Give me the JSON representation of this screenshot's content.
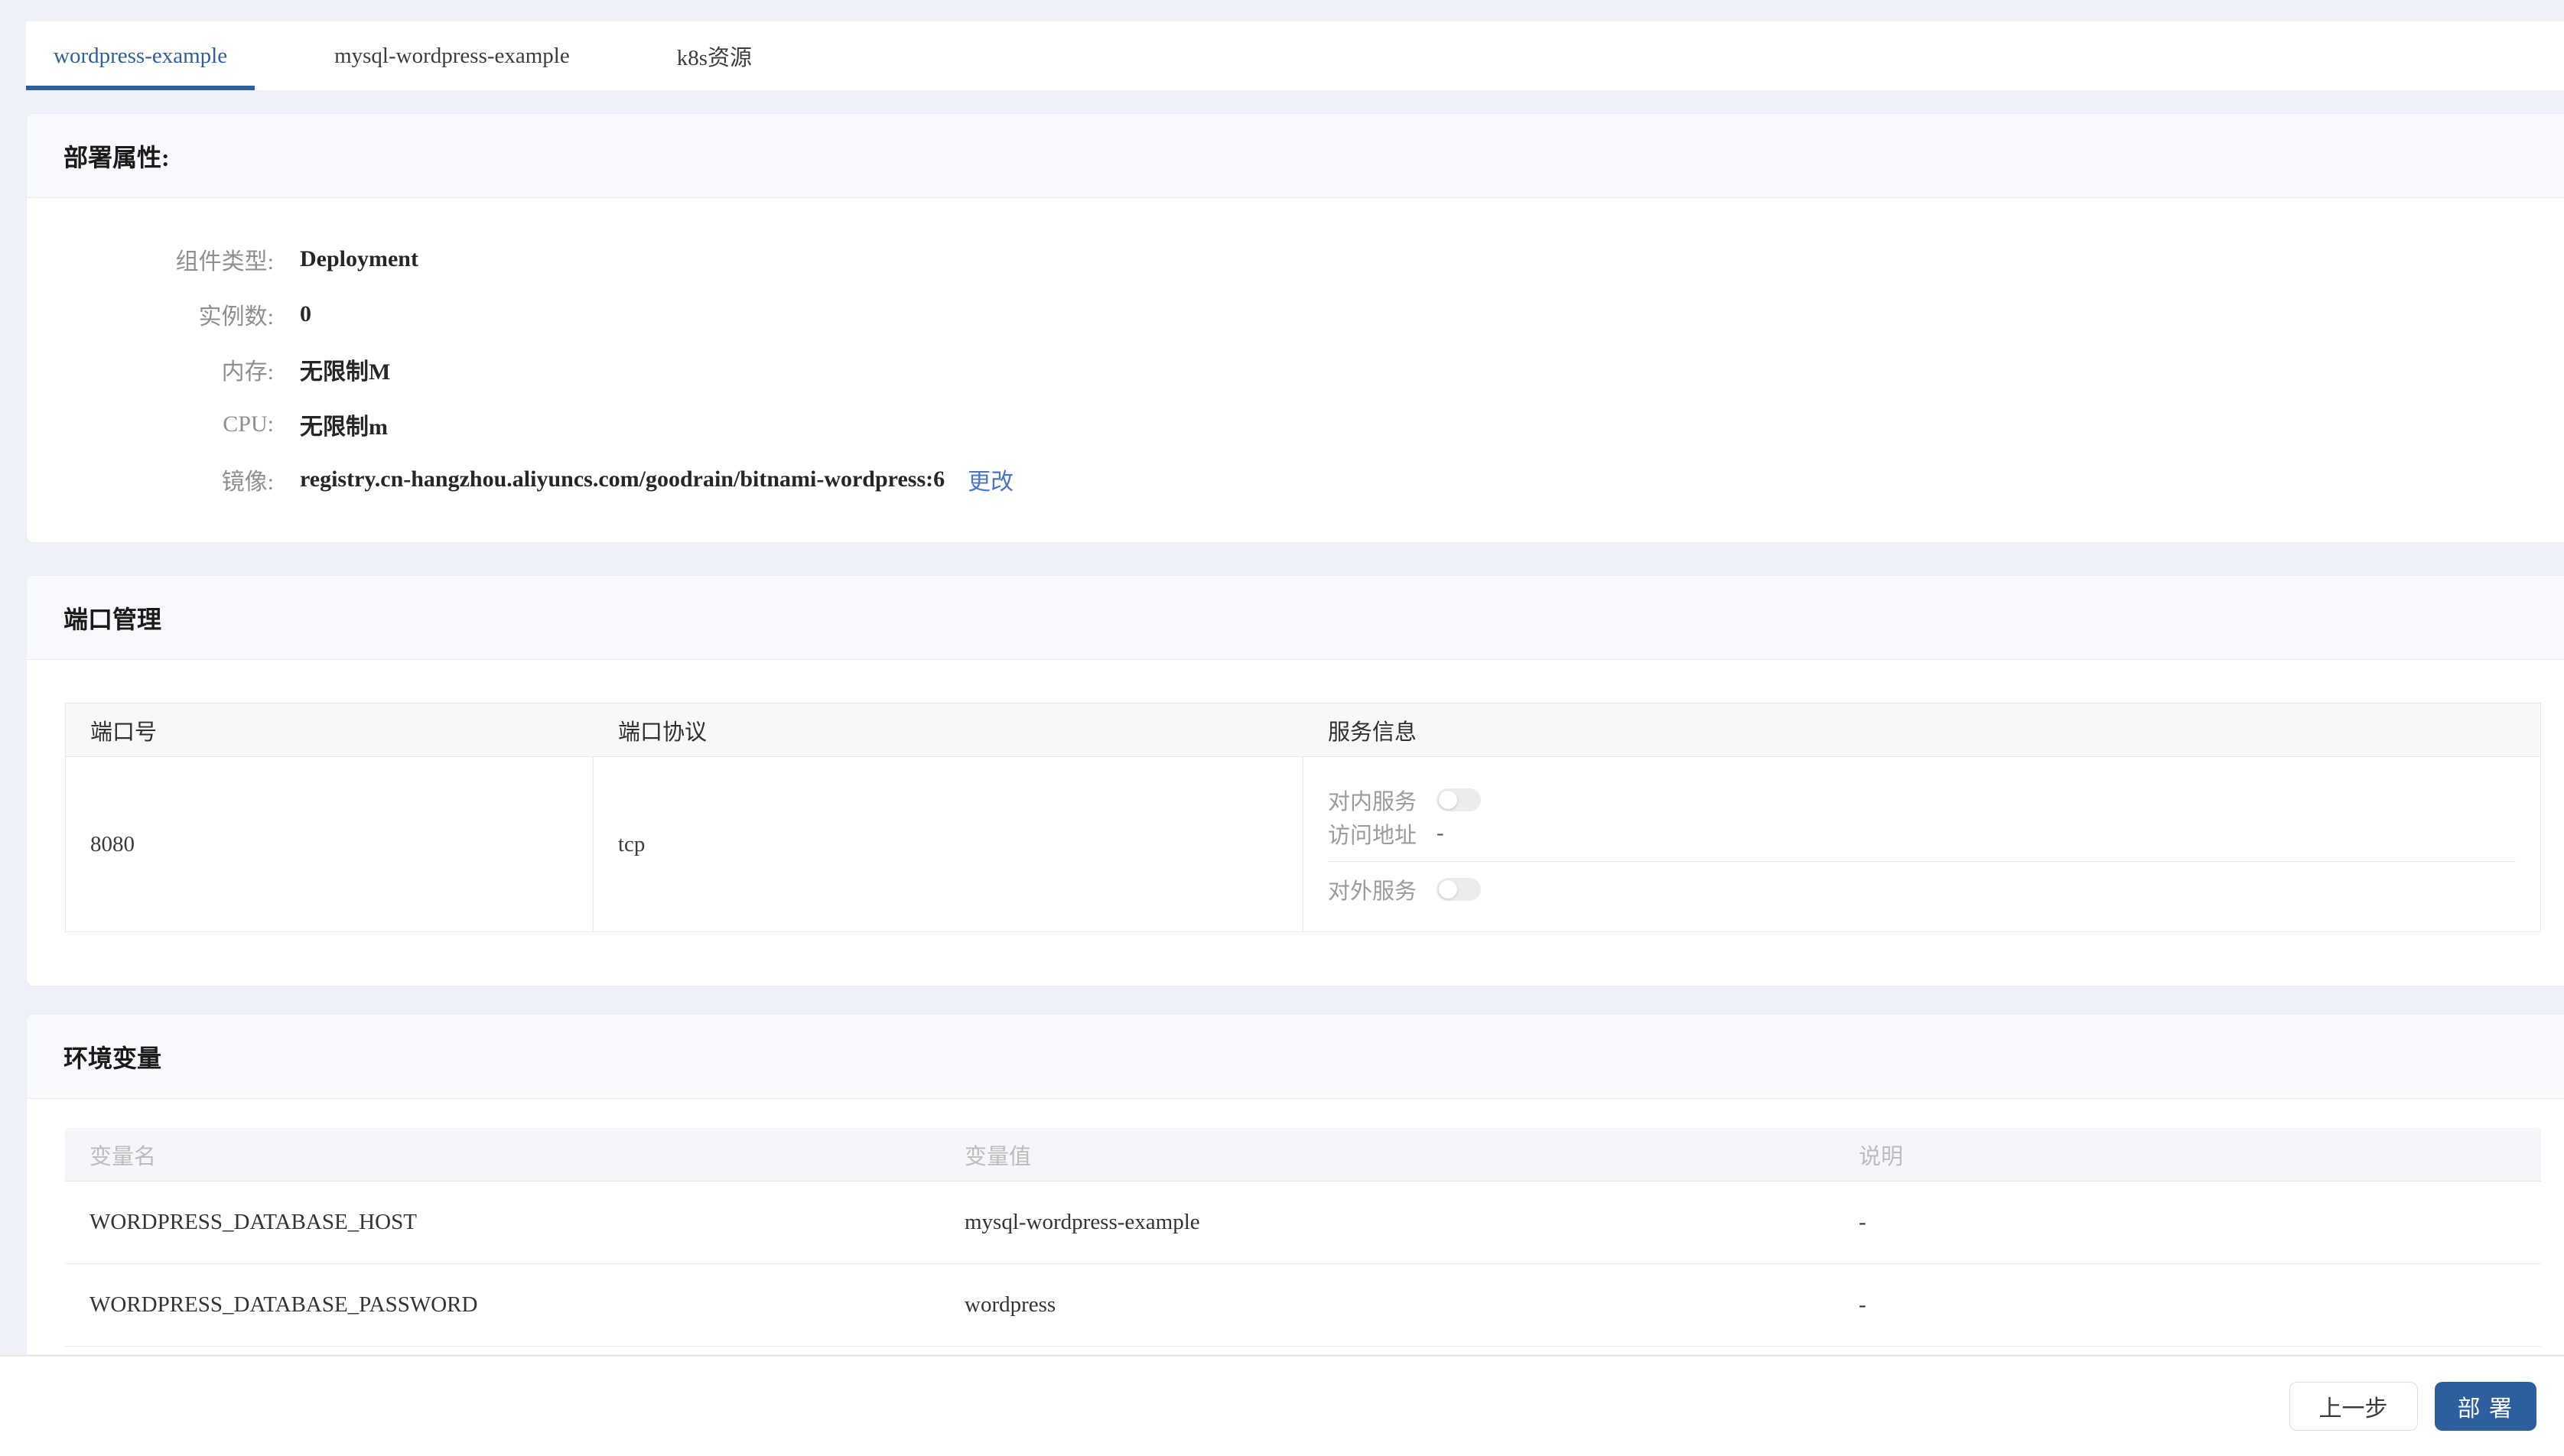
{
  "colors": {
    "accent": "#2d5f9e",
    "link": "#4a75c0"
  },
  "tabs": [
    {
      "label": "wordpress-example",
      "active": true
    },
    {
      "label": "mysql-wordpress-example",
      "active": false
    },
    {
      "label": "k8s资源",
      "active": false
    }
  ],
  "deploy_attrs": {
    "title": "部署属性:",
    "fields": [
      {
        "label": "组件类型:",
        "value": "Deployment"
      },
      {
        "label": "实例数:",
        "value": "0"
      },
      {
        "label": "内存:",
        "value": "无限制M"
      },
      {
        "label": "CPU:",
        "value": "无限制m"
      },
      {
        "label": "镜像:",
        "value": "registry.cn-hangzhou.aliyuncs.com/goodrain/bitnami-wordpress:6",
        "action": "更改"
      }
    ]
  },
  "ports": {
    "title": "端口管理",
    "headers": [
      "端口号",
      "端口协议",
      "服务信息"
    ],
    "rows": [
      {
        "port": "8080",
        "protocol": "tcp",
        "service": {
          "internal_label": "对内服务",
          "internal_on": false,
          "access_label": "访问地址",
          "access_value": "-",
          "external_label": "对外服务",
          "external_on": false
        }
      }
    ]
  },
  "env_vars": {
    "title": "环境变量",
    "headers": [
      "变量名",
      "变量值",
      "说明"
    ],
    "rows": [
      {
        "name": "WORDPRESS_DATABASE_HOST",
        "value": "mysql-wordpress-example",
        "note": "-"
      },
      {
        "name": "WORDPRESS_DATABASE_PASSWORD",
        "value": "wordpress",
        "note": "-"
      }
    ]
  },
  "footer": {
    "back_label": "上一步",
    "deploy_label": "部 署"
  }
}
